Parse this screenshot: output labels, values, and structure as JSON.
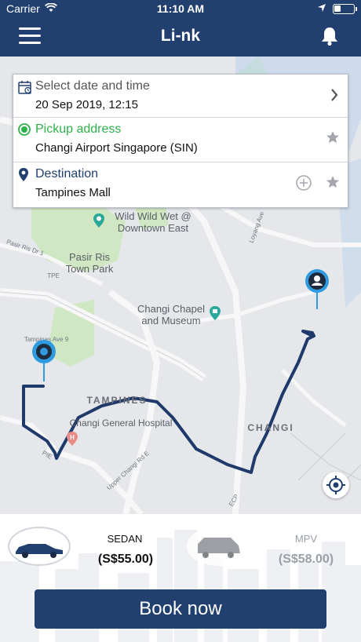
{
  "status_bar": {
    "carrier": "Carrier",
    "time": "11:10 AM"
  },
  "header": {
    "title": "Li-nk"
  },
  "form": {
    "date": {
      "label": "Select date and time",
      "value": "20 Sep 2019, 12:15"
    },
    "pickup": {
      "label": "Pickup address",
      "value": "Changi Airport Singapore (SIN)"
    },
    "destination": {
      "label": "Destination",
      "value": "Tampines Mall"
    }
  },
  "map": {
    "labels": {
      "wild_wild_wet": "Wild Wild Wet @\nDowntown East",
      "pasir_ris_park": "Pasir Ris\nTown Park",
      "changi_chapel": "Changi Chapel\nand Museum",
      "tampines": "TAMPINES",
      "changi": "CHANGI",
      "changi_hospital": "Changi General Hospital",
      "tpe": "TPE",
      "loyang_ave": "Loyang Ave",
      "pasir_ris_dr1": "Pasir Ris Dr 1",
      "tampines_ave9": "Tampines Ave 9",
      "upper_changi_rd_e": "Upper Changi Rd E",
      "ecp": "ECP",
      "pie": "PIE"
    }
  },
  "vehicles": [
    {
      "name": "SEDAN",
      "price": "(S$55.00)",
      "selected": true
    },
    {
      "name": "MPV",
      "price": "(S$58.00)",
      "selected": false
    }
  ],
  "book_button": "Book now",
  "colors": {
    "primary": "#22406f",
    "pickup_green": "#2db24a",
    "marker_blue": "#2f9ae0",
    "route": "#1f3a6a"
  }
}
